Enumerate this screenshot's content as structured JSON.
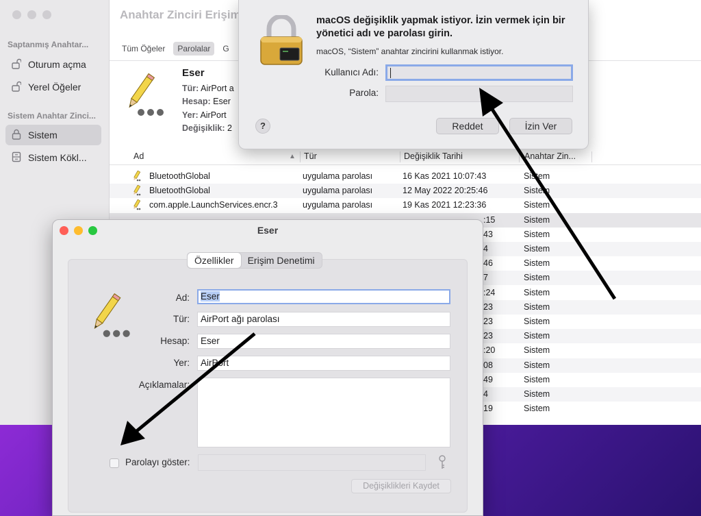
{
  "keychain": {
    "title": "Anahtar Zinciri Erişim",
    "sidebar": {
      "section_default": "Saptanmış Anahtar...",
      "items_default": [
        {
          "label": "Oturum açma",
          "icon": "lock-open-icon"
        },
        {
          "label": "Yerel Öğeler",
          "icon": "lock-open-icon"
        }
      ],
      "section_system": "Sistem Anahtar Zinci...",
      "items_system": [
        {
          "label": "Sistem",
          "icon": "lock-icon"
        },
        {
          "label": "Sistem Kökl...",
          "icon": "cabinet-icon"
        }
      ]
    },
    "tabs": [
      "Tüm Öğeler",
      "Parolalar",
      "G"
    ],
    "detail": {
      "name": "Eser",
      "type_label": "Tür:",
      "type_value": "AirPort a",
      "account_label": "Hesap:",
      "account_value": "Eser",
      "where_label": "Yer:",
      "where_value": "AirPort",
      "modified_label": "Değişiklik:",
      "modified_value": "2"
    },
    "columns": [
      "Ad",
      "Tür",
      "Değişiklik Tarihi",
      "Anahtar Zin..."
    ],
    "rows": [
      {
        "name": "BluetoothGlobal",
        "kind": "uygulama parolası",
        "date": "16 Kas 2021 10:07:43",
        "keychain": "Sistem"
      },
      {
        "name": "BluetoothGlobal",
        "kind": "uygulama parolası",
        "date": "12 May 2022 20:25:46",
        "keychain": "Sistem"
      },
      {
        "name": "com.apple.LaunchServices.encr.3",
        "kind": "uygulama parolası",
        "date": "19 Kas 2021 12:23:36",
        "keychain": "Sistem"
      },
      {
        "date_tail": ":15",
        "keychain": "Sistem"
      },
      {
        "date_tail": "43",
        "keychain": "Sistem"
      },
      {
        "date_tail": "4",
        "keychain": "Sistem"
      },
      {
        "date_tail": "46",
        "keychain": "Sistem"
      },
      {
        "date_tail": "7",
        "keychain": "Sistem"
      },
      {
        "date_tail": ":24",
        "keychain": "Sistem"
      },
      {
        "date_tail": "23",
        "keychain": "Sistem"
      },
      {
        "date_tail": "23",
        "keychain": "Sistem"
      },
      {
        "date_tail": "23",
        "keychain": "Sistem"
      },
      {
        "date_tail": ":20",
        "keychain": "Sistem"
      },
      {
        "date_tail": "08",
        "keychain": "Sistem"
      },
      {
        "date_tail": "49",
        "keychain": "Sistem"
      },
      {
        "date_tail": "4",
        "keychain": "Sistem"
      },
      {
        "date_tail": "19",
        "keychain": "Sistem"
      }
    ]
  },
  "auth_dialog": {
    "title": "macOS değişiklik yapmak istiyor. İzin vermek için bir yönetici adı ve parolası girin.",
    "subtitle": "macOS, “Sistem” anahtar zincirini kullanmak istiyor.",
    "username_label": "Kullanıcı Adı:",
    "username_value": "",
    "password_label": "Parola:",
    "help": "?",
    "deny": "Reddet",
    "allow": "İzin Ver"
  },
  "detail_window": {
    "title": "Eser",
    "tabs": [
      "Özellikler",
      "Erişim Denetimi"
    ],
    "fields": {
      "name_label": "Ad:",
      "name_value": "Eser",
      "kind_label": "Tür:",
      "kind_value": "AirPort ağı parolası",
      "account_label": "Hesap:",
      "account_value": "Eser",
      "where_label": "Yer:",
      "where_value": "AirPort",
      "comments_label": "Açıklamalar:"
    },
    "show_password_label": "Parolayı göster:",
    "save_button": "Değişiklikleri Kaydet"
  },
  "colors": {
    "traffic_red": "#ff5f57",
    "traffic_yellow": "#febc2e",
    "traffic_green": "#28c840",
    "focus_ring": "#8aa9e8",
    "arrow": "#000000"
  }
}
